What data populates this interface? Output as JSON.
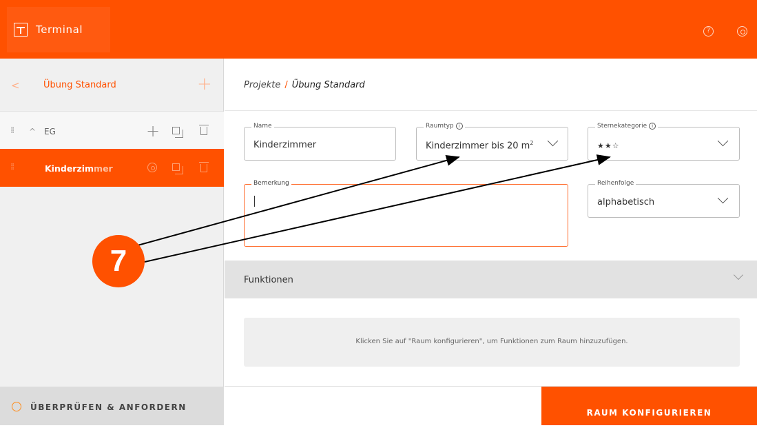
{
  "app": {
    "name": "Terminal"
  },
  "header": {
    "help_glyph": "?"
  },
  "sidebar": {
    "back_glyph": "<",
    "project_name": "Übung Standard",
    "add_glyph": "+",
    "floor": {
      "drag_glyph": "⁞⁞",
      "chevron_glyph": "^",
      "label": "EG",
      "add_glyph": "+"
    },
    "room": {
      "drag_glyph": "⁞⁞",
      "label_main": "Kinderzim",
      "label_fade": "mer"
    },
    "footer_label": "ÜBERPRÜFEN & ANFORDERN"
  },
  "breadcrumb": {
    "root": "Projekte",
    "sep": "/",
    "current": "Übung Standard"
  },
  "form": {
    "name": {
      "label": "Name",
      "value": "Kinderzimmer"
    },
    "raumtyp": {
      "label": "Raumtyp",
      "value": "Kinderzimmer bis 20 m",
      "sup": "2"
    },
    "sterne": {
      "label": "Sternekategorie",
      "value": "★★☆"
    },
    "bemerkung": {
      "label": "Bemerkung",
      "value": ""
    },
    "reihenfolge": {
      "label": "Reihenfolge",
      "value": "alphabetisch"
    },
    "info_glyph": "i"
  },
  "functions": {
    "title": "Funktionen",
    "hint": "Klicken Sie auf \"Raum konfigurieren\", um Funktionen zum Raum hinzuzufügen."
  },
  "configure_label": "RAUM KONFIGURIEREN",
  "annotation": {
    "step": "7",
    "color": "#ff5100"
  },
  "colors": {
    "accent": "#ff5100",
    "status": "#ff8c1a"
  }
}
